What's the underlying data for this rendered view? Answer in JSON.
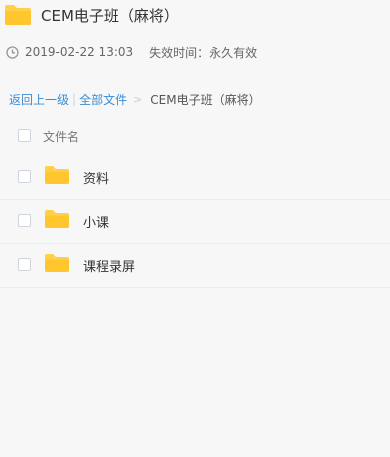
{
  "header": {
    "title": "CEM电子班（麻将）",
    "icon": "folder-icon"
  },
  "meta": {
    "date": "2019-02-22 13:03",
    "expiry": "失效时间：永久有效"
  },
  "breadcrumb": {
    "back": "返回上一级",
    "separator": "|",
    "all_files": "全部文件",
    "arrow": ">",
    "current": "CEM电子班（麻将）"
  },
  "list": {
    "column_name": "文件名",
    "items": [
      {
        "name": "资料",
        "icon": "folder-icon"
      },
      {
        "name": "小课",
        "icon": "folder-icon"
      },
      {
        "name": "课程录屏",
        "icon": "folder-icon"
      }
    ]
  },
  "colors": {
    "folder": "#ffd04a",
    "link": "#3b8cd6",
    "background": "#f7f7f7"
  }
}
